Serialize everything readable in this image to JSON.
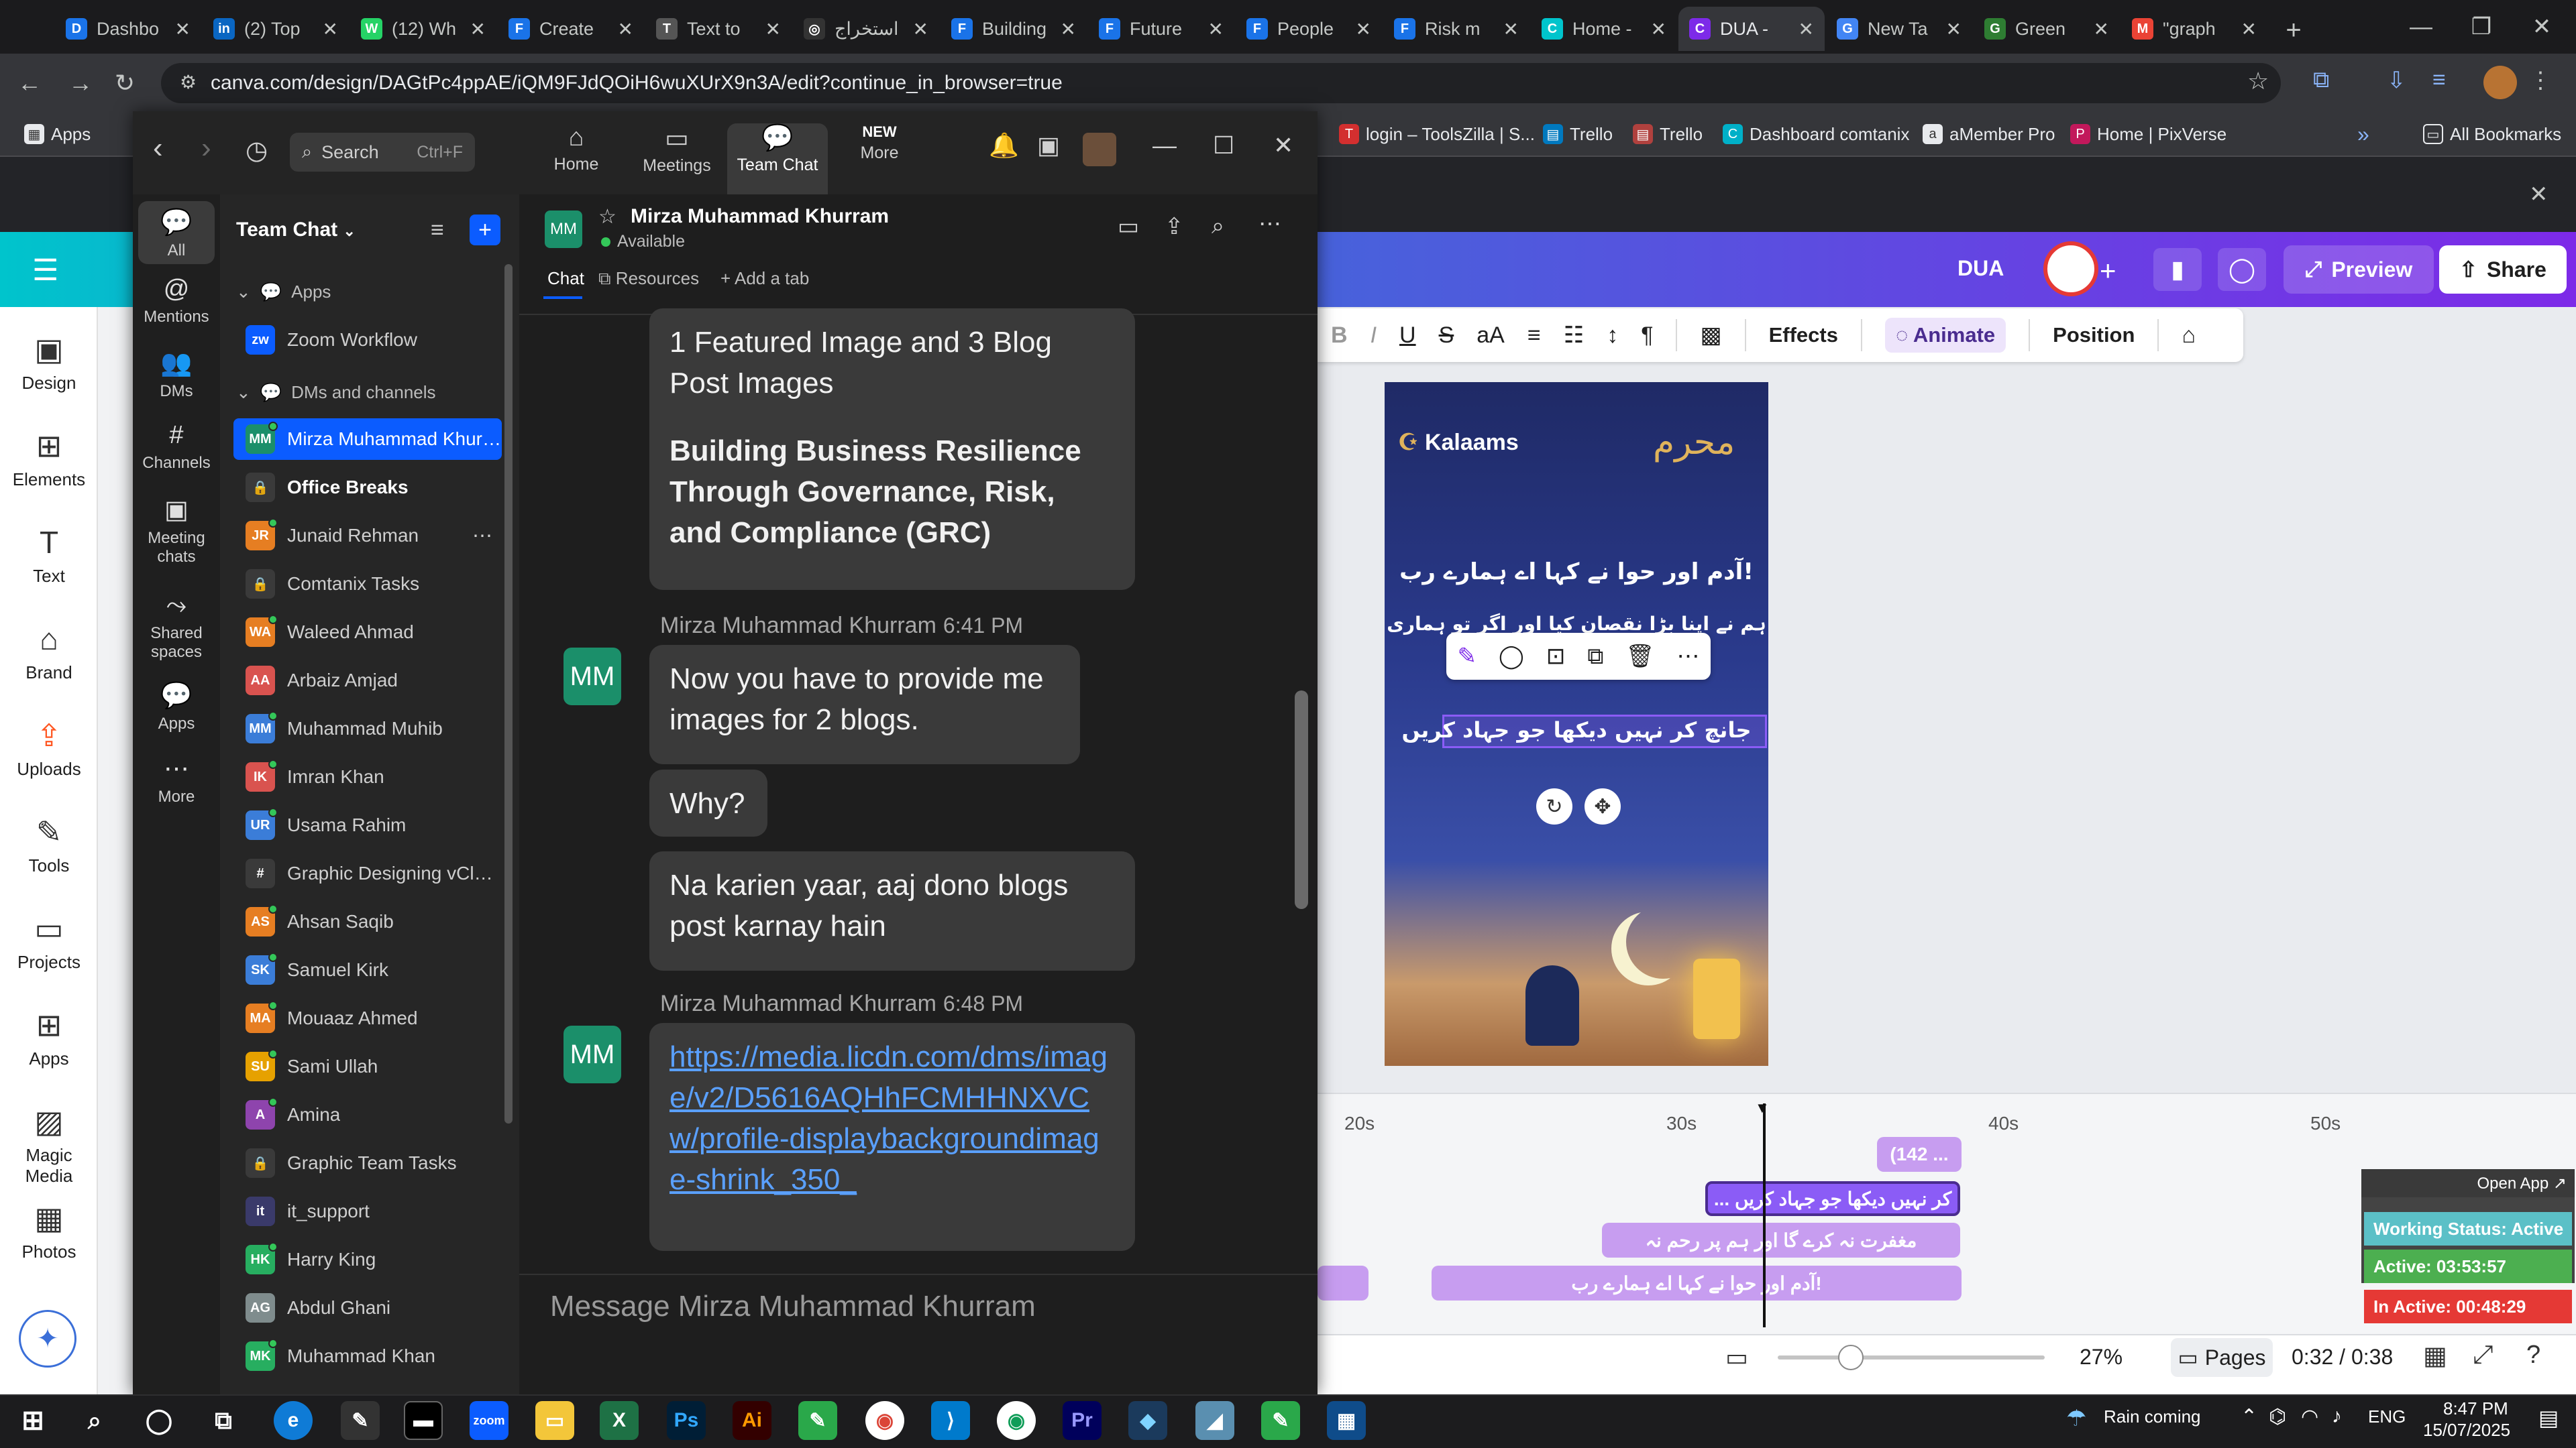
{
  "browser": {
    "tabs": [
      {
        "title": "Dashbo",
        "fav": "D",
        "color": "#1a73e8"
      },
      {
        "title": "(2) Top",
        "fav": "in",
        "color": "#0a66c2"
      },
      {
        "title": "(12) Wh",
        "fav": "W",
        "color": "#25d366"
      },
      {
        "title": "Create",
        "fav": "F",
        "color": "#1a73e8"
      },
      {
        "title": "Text to",
        "fav": "T",
        "color": "#555"
      },
      {
        "title": "استخراج",
        "fav": "◎",
        "color": "#333"
      },
      {
        "title": "Building",
        "fav": "F",
        "color": "#1a73e8"
      },
      {
        "title": "Future",
        "fav": "F",
        "color": "#1a73e8"
      },
      {
        "title": "People",
        "fav": "F",
        "color": "#1a73e8"
      },
      {
        "title": "Risk m",
        "fav": "F",
        "color": "#1a73e8"
      },
      {
        "title": "Home -",
        "fav": "C",
        "color": "#00c4cc"
      },
      {
        "title": "DUA -",
        "fav": "C",
        "color": "#7d2ae8"
      },
      {
        "title": "New Ta",
        "fav": "G",
        "color": "#4285f4"
      },
      {
        "title": "Green",
        "fav": "G",
        "color": "#2e7d32"
      },
      {
        "title": "\"graph",
        "fav": "M",
        "color": "#ea4335"
      }
    ],
    "url": "canva.com/design/DAGtPc4ppAE/iQM9FJdQOiH6wuXUrX9n3A/edit?continue_in_browser=true",
    "bookmarks": [
      "Apps",
      "login – ToolsZilla | S...",
      "Trello",
      "Trello",
      "Dashboard comtanix",
      "aMember Pro",
      "Home | PixVerse",
      "All Bookmarks"
    ]
  },
  "canva": {
    "left_items": [
      "Design",
      "Elements",
      "Text",
      "Brand",
      "Uploads",
      "Tools",
      "Projects",
      "Apps",
      "Magic Media",
      "Photos"
    ],
    "doc_title": "DUA",
    "preview": "Preview",
    "share": "Share",
    "toolbar": {
      "effects": "Effects",
      "animate": "Animate",
      "position": "Position"
    },
    "design": {
      "brand": "Kalaams",
      "line1": "آدم اور حوا نے کہا اے ہمارے رب!",
      "line2": "ہم نے اپنا بڑا نقصان کیا اور اگر تو ہماری",
      "line3": "جانچ کر نہیں دیکھا جو جہاد کریں"
    },
    "timeline": {
      "ticks": [
        "20s",
        "30s",
        "40s",
        "50s"
      ],
      "clips": [
        "(142 ...",
        "... کر نہیں دیکھا جو جہاد کریں",
        "مغفرت نہ کرے گا اور ہم پر رحم نہ",
        "آدم اور حوا نے کہا اے ہمارے رب!"
      ]
    },
    "zoom": "27%",
    "pages": "Pages",
    "time": "0:32 / 0:38"
  },
  "tracker": {
    "open_app": "Open App ↗",
    "status": "Working Status: Active",
    "active": "Active: 03:53:57",
    "inactive": "In Active: 00:48:29"
  },
  "zoom": {
    "search_placeholder": "Search",
    "search_shortcut": "Ctrl+F",
    "top_tabs": [
      "Home",
      "Meetings",
      "Team Chat",
      "More"
    ],
    "more_badge": "NEW",
    "rail": [
      "All",
      "Mentions",
      "DMs",
      "Channels",
      "Meeting chats",
      "Shared spaces",
      "Apps",
      "More"
    ],
    "list_title": "Team Chat",
    "section_apps": "Apps",
    "section_dms": "DMs and channels",
    "items": [
      {
        "name": "Zoom Workflow",
        "initials": "zw",
        "color": "#0b5cff"
      },
      {
        "name": "Mirza Muhammad Khurr...",
        "initials": "MM",
        "color": "#1b8f6a"
      },
      {
        "name": "Office Breaks",
        "initials": "🔒",
        "color": "#3a3a3a"
      },
      {
        "name": "Junaid Rehman",
        "initials": "JR",
        "color": "#e67e22"
      },
      {
        "name": "Comtanix Tasks",
        "initials": "🔒",
        "color": "#3a3a3a"
      },
      {
        "name": "Waleed Ahmad",
        "initials": "WA",
        "color": "#e67e22"
      },
      {
        "name": "Arbaiz Amjad",
        "initials": "AA",
        "color": "#d9534f"
      },
      {
        "name": "Muhammad Muhib",
        "initials": "MM",
        "color": "#3b7dd8"
      },
      {
        "name": "Imran Khan",
        "initials": "IK",
        "color": "#d9534f"
      },
      {
        "name": "Usama Rahim",
        "initials": "UR",
        "color": "#3b7dd8"
      },
      {
        "name": "Graphic Designing vCloud",
        "initials": "#",
        "color": "#3a3a3a"
      },
      {
        "name": "Ahsan Saqib",
        "initials": "AS",
        "color": "#e67e22"
      },
      {
        "name": "Samuel Kirk",
        "initials": "SK",
        "color": "#3b7dd8"
      },
      {
        "name": "Mouaaz Ahmed",
        "initials": "MA",
        "color": "#e67e22"
      },
      {
        "name": "Sami Ullah",
        "initials": "SU",
        "color": "#e6a100"
      },
      {
        "name": "Amina",
        "initials": "A",
        "color": "#8e44ad"
      },
      {
        "name": "Graphic Team Tasks",
        "initials": "🔒",
        "color": "#3a3a3a"
      },
      {
        "name": "it_support",
        "initials": "it",
        "color": "#3a3a6a"
      },
      {
        "name": "Harry King",
        "initials": "HK",
        "color": "#27ae60"
      },
      {
        "name": "Abdul Ghani",
        "initials": "AG",
        "color": "#7f8c8d"
      },
      {
        "name": "Muhammad Khan",
        "initials": "MK",
        "color": "#27ae60"
      }
    ],
    "chat": {
      "contact": "Mirza Muhammad Khurram",
      "status": "Available",
      "tabs": [
        "Chat",
        "Resources",
        "+ Add a tab"
      ],
      "bubble1_line1": "1 Featured Image and 3 Blog Post Images",
      "bubble1_bold": "Building Business Resilience Through Governance, Risk, and Compliance (GRC)",
      "sender": "Mirza Muhammad Khurram",
      "time1": "6:41 PM",
      "msg1": "Now you have to provide me images for 2 blogs.",
      "msg2": "Why?",
      "msg3": "Na karien yaar, aaj dono blogs post karnay hain",
      "time2": "6:48 PM",
      "link": "https://media.licdn.com/dms/image/v2/D5616AQHhFCMHHNXVCw/profile-displaybackgroundimage-shrink_350_",
      "composer_placeholder": "Message Mirza Muhammad Khurram"
    }
  },
  "taskbar": {
    "weather": "Rain coming",
    "lang": "ENG",
    "time": "8:47 PM",
    "date": "15/07/2025"
  }
}
